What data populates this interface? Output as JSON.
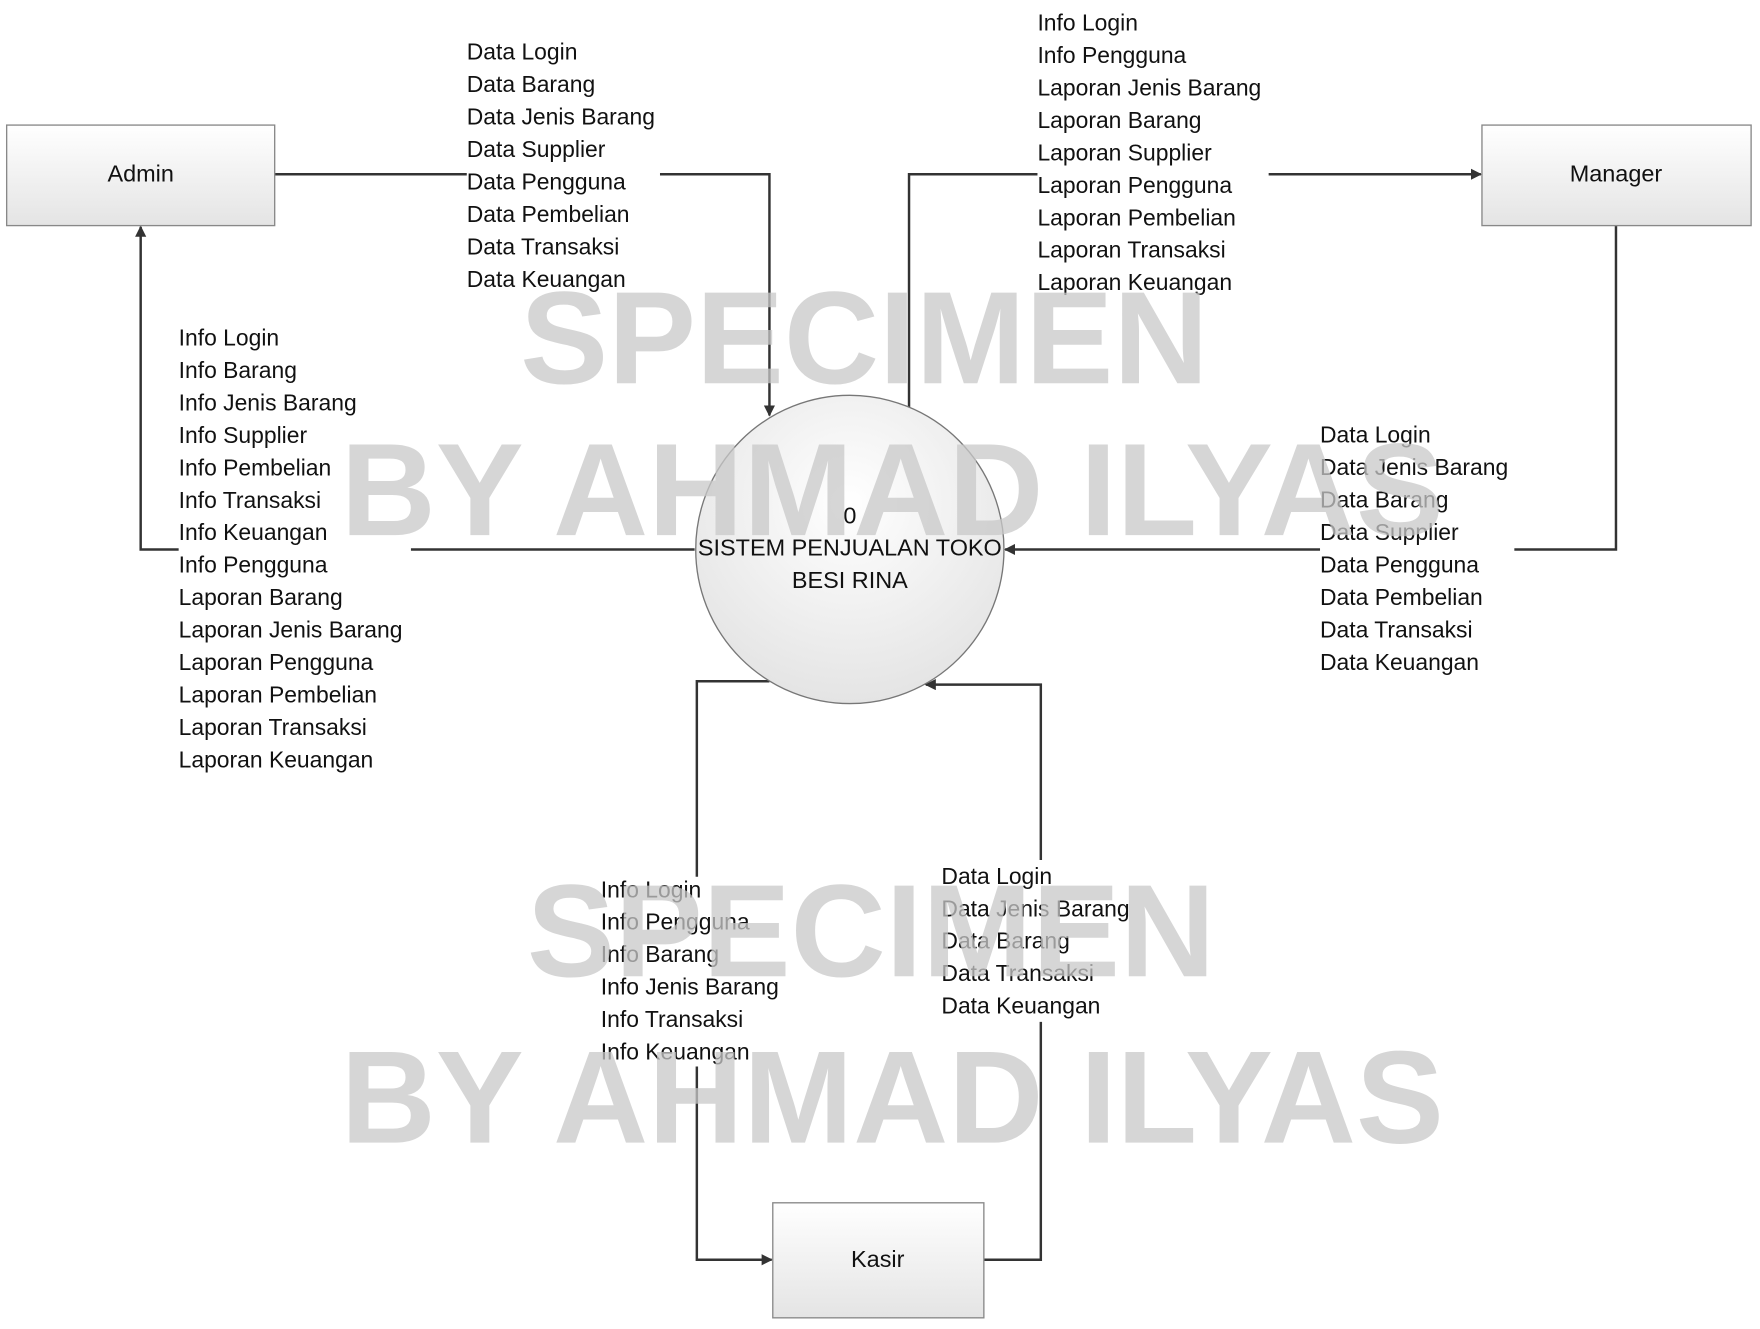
{
  "process": {
    "number": "0",
    "name_line1": "SISTEM PENJUALAN TOKO",
    "name_line2": "BESI RINA"
  },
  "entities": {
    "admin": "Admin",
    "manager": "Manager",
    "kasir": "Kasir"
  },
  "watermark": {
    "line1": "SPECIMEN",
    "line2": "BY AHMAD ILYAS"
  },
  "flows": {
    "admin_to_system": [
      "Data Login",
      "Data Barang",
      "Data Jenis Barang",
      "Data Supplier",
      "Data Pengguna",
      "Data Pembelian",
      "Data Transaksi",
      "Data Keuangan"
    ],
    "system_to_manager": [
      "Info Login",
      "Info Pengguna",
      "Laporan Jenis Barang",
      "Laporan Barang",
      "Laporan Supplier",
      "Laporan Pengguna",
      "Laporan Pembelian",
      "Laporan Transaksi",
      "Laporan Keuangan"
    ],
    "system_to_admin": [
      "Info Login",
      "Info Barang",
      "Info Jenis Barang",
      "Info Supplier",
      "Info Pembelian",
      "Info Transaksi",
      "Info Keuangan",
      "Info Pengguna",
      "Laporan Barang",
      "Laporan Jenis Barang",
      "Laporan Pengguna",
      "Laporan Pembelian",
      "Laporan Transaksi",
      "Laporan Keuangan"
    ],
    "manager_to_system": [
      "Data Login",
      "Data Jenis Barang",
      "Data Barang",
      "Data Supplier",
      "Data Pengguna",
      "Data Pembelian",
      "Data Transaksi",
      "Data Keuangan"
    ],
    "system_to_kasir": [
      "Info Login",
      "Info Pengguna",
      "Info Barang",
      "Info Jenis Barang",
      "Info Transaksi",
      "Info Keuangan"
    ],
    "kasir_to_system": [
      "Data Login",
      "Data Jenis Barang",
      "Data Barang",
      "Data Transaksi",
      "Data Keuangan"
    ]
  }
}
